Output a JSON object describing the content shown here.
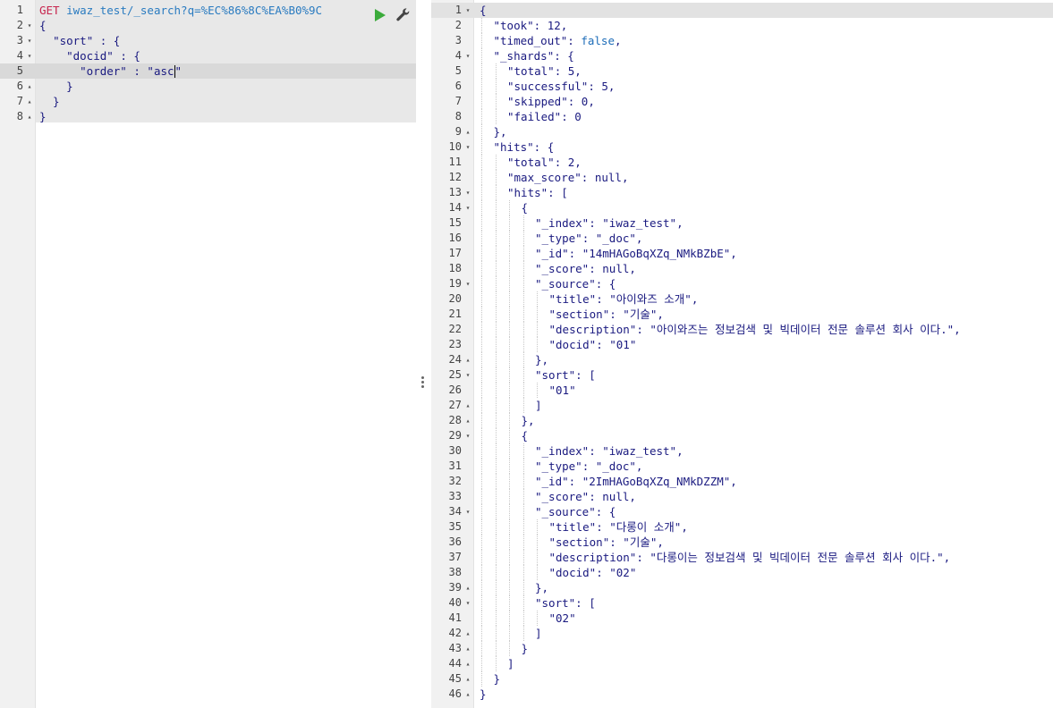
{
  "request": {
    "method": "GET",
    "url": "iwaz_test/_search?q=%EC%86%8C%EA%B0%9C",
    "sort_key": "\"sort\"",
    "docid_key": "\"docid\"",
    "order_key": "\"order\"",
    "order_value": "\"asc\"",
    "lines": [
      {
        "n": "1",
        "fold": ""
      },
      {
        "n": "2",
        "fold": "▾"
      },
      {
        "n": "3",
        "fold": "▾"
      },
      {
        "n": "4",
        "fold": "▾"
      },
      {
        "n": "5",
        "fold": ""
      },
      {
        "n": "6",
        "fold": "▴"
      },
      {
        "n": "7",
        "fold": "▴"
      },
      {
        "n": "8",
        "fold": "▴"
      }
    ]
  },
  "response": {
    "line_numbers": [
      "1",
      "2",
      "3",
      "4",
      "5",
      "6",
      "7",
      "8",
      "9",
      "10",
      "11",
      "12",
      "13",
      "14",
      "15",
      "16",
      "17",
      "18",
      "19",
      "20",
      "21",
      "22",
      "23",
      "24",
      "25",
      "26",
      "27",
      "28",
      "29",
      "30",
      "31",
      "32",
      "33",
      "34",
      "35",
      "36",
      "37",
      "38",
      "39",
      "40",
      "41",
      "42",
      "43",
      "44",
      "45",
      "46"
    ],
    "folds": [
      "▾",
      "",
      "",
      "▾",
      "",
      "",
      "",
      "",
      "▴",
      "▾",
      "",
      "",
      "▾",
      "▾",
      "",
      "",
      "",
      "",
      "▾",
      "",
      "",
      "",
      "",
      "▴",
      "▾",
      "",
      "▴",
      "▴",
      "▾",
      "",
      "",
      "",
      "",
      "▾",
      "",
      "",
      "",
      "",
      "▴",
      "▾",
      "",
      "▴",
      "▴",
      "▴",
      "▴",
      "▴"
    ],
    "took": "12",
    "timed_out": "false",
    "shards": {
      "total": "5",
      "successful": "5",
      "skipped": "0",
      "failed": "0"
    },
    "hits_total": "2",
    "max_score": "null",
    "docs": [
      {
        "index": "\"iwaz_test\"",
        "type": "\"_doc\"",
        "id": "\"14mHAGoBqXZq_NMkBZbE\"",
        "score": "null",
        "title": "\"아이와즈 소개\"",
        "section": "\"기술\"",
        "description": "\"아이와즈는 정보검색 및 빅데이터 전문 솔루션 회사 이다.\"",
        "docid": "\"01\"",
        "sort": "\"01\""
      },
      {
        "index": "\"iwaz_test\"",
        "type": "\"_doc\"",
        "id": "\"2ImHAGoBqXZq_NMkDZZM\"",
        "score": "null",
        "title": "\"다롱이 소개\"",
        "section": "\"기술\"",
        "description": "\"다롱이는 정보검색 및 빅데이터 전문 솔루션 회사 이다.\"",
        "docid": "\"02\"",
        "sort": "\"02\""
      }
    ]
  }
}
